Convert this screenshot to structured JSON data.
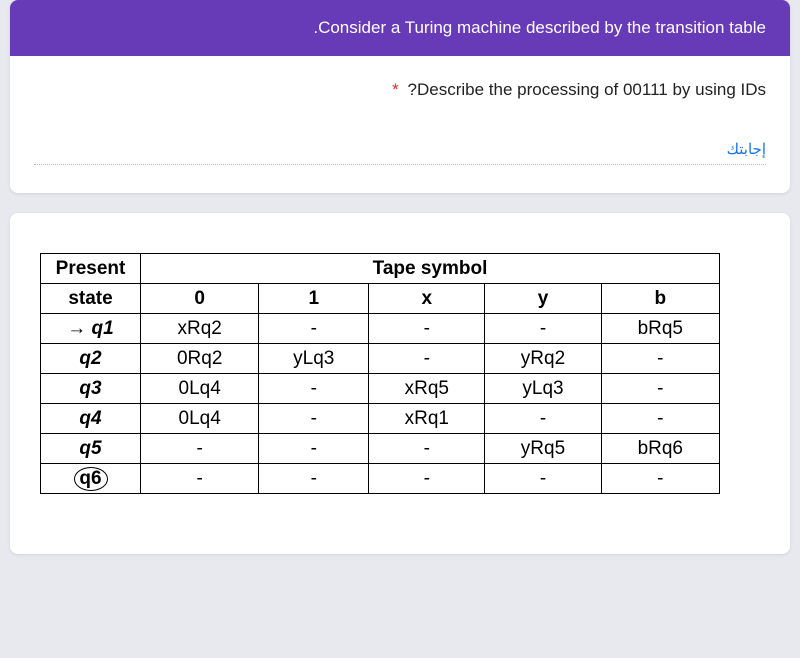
{
  "header": {
    "title": ".Consider a Turing machine described by the transition table"
  },
  "question": {
    "required_mark": "*",
    "text": "?Describe the processing of 00111 by using IDs",
    "answer_label": "إجابتك"
  },
  "table": {
    "corner_top": "Present",
    "corner_bottom": "state",
    "tape_header": "Tape symbol",
    "symbols": [
      "0",
      "1",
      "x",
      "y",
      "b"
    ],
    "rows": [
      {
        "state": "q1",
        "is_start": true,
        "is_final": false,
        "cells": [
          "xRq2",
          "-",
          "-",
          "-",
          "bRq5"
        ]
      },
      {
        "state": "q2",
        "is_start": false,
        "is_final": false,
        "cells": [
          "0Rq2",
          "yLq3",
          "-",
          "yRq2",
          "-"
        ]
      },
      {
        "state": "q3",
        "is_start": false,
        "is_final": false,
        "cells": [
          "0Lq4",
          "-",
          "xRq5",
          "yLq3",
          "-"
        ]
      },
      {
        "state": "q4",
        "is_start": false,
        "is_final": false,
        "cells": [
          "0Lq4",
          "-",
          "xRq1",
          "-",
          "-"
        ]
      },
      {
        "state": "q5",
        "is_start": false,
        "is_final": false,
        "cells": [
          "-",
          "-",
          "-",
          "yRq5",
          "bRq6"
        ]
      },
      {
        "state": "q6",
        "is_start": false,
        "is_final": true,
        "cells": [
          "-",
          "-",
          "-",
          "-",
          "-"
        ]
      }
    ]
  }
}
